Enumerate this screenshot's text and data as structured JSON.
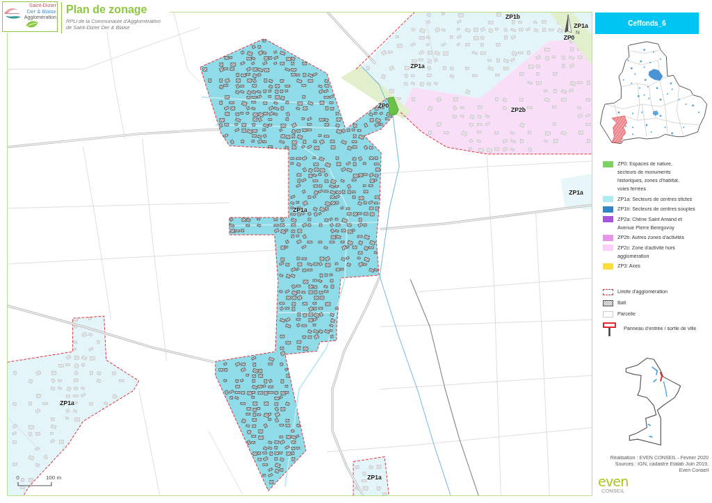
{
  "header": {
    "logo": {
      "name_line_1": "Saint-Dizier",
      "name_line_2": "Der & Blaise",
      "tagline": "Agglomération"
    },
    "title": "Plan de zonage",
    "subtitle_lines": [
      "RPLi de la Communauté d'Agglomération",
      "de Saint-Dizier Der & Blaise"
    ]
  },
  "map": {
    "zone_labels": [
      "ZP1b",
      "ZP1a",
      "ZP0",
      "ZP1a",
      "ZP0",
      "ZP2b",
      "ZP1a",
      "ZP1a",
      "ZP1a",
      "ZP1a"
    ],
    "north_label": "N",
    "scale_bar": {
      "start": "0",
      "end": "100 m"
    }
  },
  "legend": {
    "commune": "Ceffonds_6",
    "zones": [
      {
        "kind": "fill",
        "color": "#7dd35f",
        "lines": [
          "ZP0: Espaces de nature,",
          "secteurs de monuments",
          "historiques, zones d'habitat,",
          "voies ferrées"
        ]
      },
      {
        "kind": "fill",
        "color": "#aeeaf2",
        "lines": [
          "ZP1a: Secteurs de centres stictes"
        ]
      },
      {
        "kind": "fill",
        "color": "#2f86c4",
        "lines": [
          "ZP1b: Secteurs de centres souples"
        ]
      },
      {
        "kind": "fill",
        "color": "#a855d9",
        "lines": [
          "ZP2a: Chêne Saint Amand et",
          "Avenue Pierre Beregovoy"
        ]
      },
      {
        "kind": "fill",
        "color": "#e994ea",
        "lines": [
          "ZP2b: Autres zones d'activités"
        ]
      },
      {
        "kind": "fill",
        "color": "#fbd0f8",
        "lines": [
          "ZP2c: Zone d'activité hors",
          "agglomération"
        ]
      },
      {
        "kind": "fill",
        "color": "#fddc3c",
        "lines": [
          "ZP3: Axes"
        ]
      }
    ],
    "symbols": [
      {
        "kind": "dashed",
        "color": "#e3262d",
        "lines": [
          "Limite d'agglomération"
        ]
      },
      {
        "kind": "hatch",
        "color": "#555555",
        "lines": [
          "Bati"
        ]
      },
      {
        "kind": "outline",
        "color": "#cccccc",
        "lines": [
          "Parcelle"
        ]
      },
      {
        "kind": "sign",
        "color": "#e3262d",
        "lines": [
          "Panneau d'entrée / sortie de ville"
        ]
      }
    ]
  },
  "footer": {
    "logo": {
      "wordmark": "even",
      "subtitle": "CONSEIL"
    },
    "credits": [
      "Réalisation : EVEN CONSEIL - Février 2020",
      "Sources : IGN, cadastre Etalab Juin 2019,",
      "Even Conseil"
    ]
  }
}
